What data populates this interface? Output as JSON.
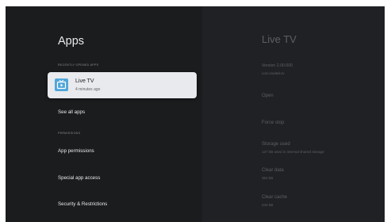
{
  "left": {
    "title": "Apps",
    "recent_header": "RECENTLY OPENED APPS",
    "recent_app": {
      "name": "Live TV",
      "time": "4 minutes ago",
      "icon": "tv-icon"
    },
    "see_all": "See all apps",
    "permissions_header": "PERMISSIONS",
    "app_permissions": "App permissions",
    "special_access": "Special app access",
    "security": "Security & Restrictions"
  },
  "right": {
    "title": "Live TV",
    "version": "Version 2.00.000",
    "package": "com.realtek.tv",
    "open": "Open",
    "force_stop": "Force stop",
    "storage_used": "Storage used",
    "storage_detail": "127 kB used in internal shared storage",
    "clear_data": "Clear data",
    "clear_data_size": "354 kB",
    "clear_cache": "Clear cache",
    "clear_cache_size": "244 kB"
  },
  "colors": {
    "accent_icon": "#4fa6d9",
    "card": "#e8eaed",
    "panel_left": "#1b1c1e",
    "panel_right": "#202124"
  }
}
